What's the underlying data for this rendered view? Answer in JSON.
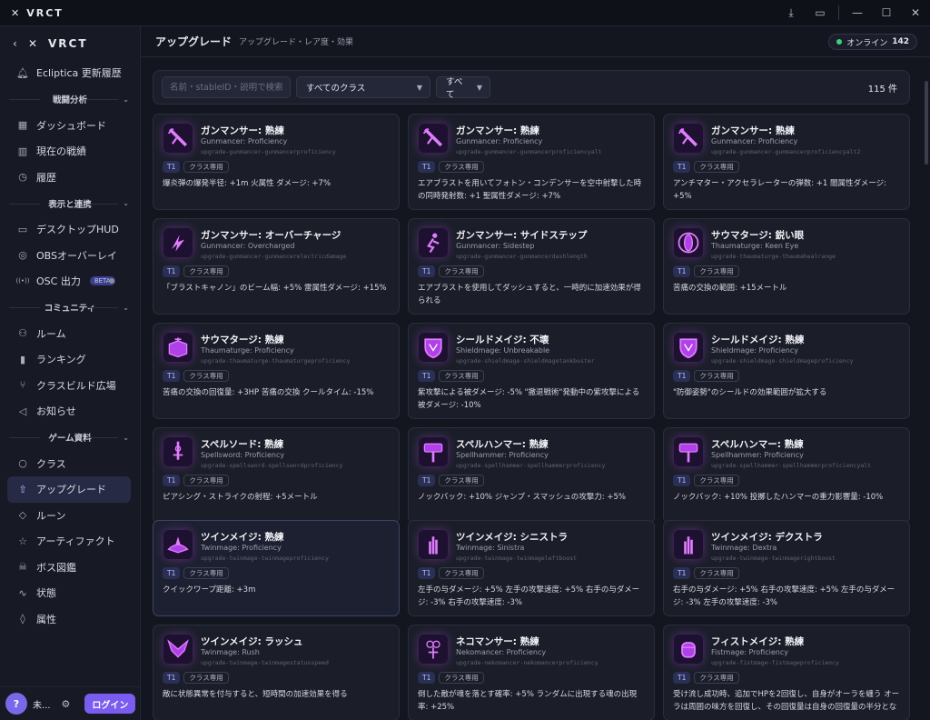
{
  "app": {
    "title": "VRCT"
  },
  "window": {
    "controls": [
      "download",
      "chat",
      "minimize",
      "maximize",
      "close"
    ]
  },
  "sidebar": {
    "brand": "VRCT",
    "top_item": {
      "label": "Ecliptica 更新履歴",
      "icon": "bell-icon"
    },
    "sections": [
      {
        "title": "戦闘分析",
        "items": [
          {
            "label": "ダッシュボード",
            "icon": "dashboard-icon"
          },
          {
            "label": "現在の戦績",
            "icon": "bars-icon"
          },
          {
            "label": "履歴",
            "icon": "clock-icon"
          }
        ]
      },
      {
        "title": "表示と連携",
        "items": [
          {
            "label": "デスクトップHUD",
            "icon": "monitor-icon"
          },
          {
            "label": "OBSオーバーレイ",
            "icon": "target-icon"
          },
          {
            "label": "OSC 出力",
            "icon": "signal-icon",
            "badge": "BETA"
          }
        ]
      },
      {
        "title": "コミュニティ",
        "items": [
          {
            "label": "ルーム",
            "icon": "users-icon"
          },
          {
            "label": "ランキング",
            "icon": "chart-icon"
          },
          {
            "label": "クラスビルド広場",
            "icon": "branch-icon"
          },
          {
            "label": "お知らせ",
            "icon": "speaker-icon"
          }
        ]
      },
      {
        "title": "ゲーム資料",
        "items": [
          {
            "label": "クラス",
            "icon": "circle-icon"
          },
          {
            "label": "アップグレード",
            "icon": "arrow-up-icon",
            "active": true
          },
          {
            "label": "ルーン",
            "icon": "diamond-icon"
          },
          {
            "label": "アーティファクト",
            "icon": "star-icon"
          },
          {
            "label": "ボス図鑑",
            "icon": "skull-icon"
          },
          {
            "label": "状態",
            "icon": "pulse-icon"
          },
          {
            "label": "属性",
            "icon": "drop-icon"
          }
        ]
      }
    ],
    "footer": {
      "avatar": "?",
      "user": "未...",
      "login": "ログイン"
    }
  },
  "header": {
    "title": "アップグレード",
    "subtitle": "アップグレード・レア度・効果",
    "online_label": "オンライン",
    "online_count": "142"
  },
  "filters": {
    "search_placeholder": "名前・stableID・説明で検索",
    "class_select": "すべてのクラス",
    "type_select": "すべて",
    "count": "115 件"
  },
  "colors": {
    "accent": "#7b5cf0",
    "tier_badge": "#2a2f55",
    "online": "#3ed17a",
    "icon_glow": "#d070ff"
  },
  "cards": [
    {
      "name": "ガンマンサー: 熟練",
      "en": "Gunmancer: Proficiency",
      "id": "upgrade-gunmancer-gunmancerproficiency",
      "tier": "T1",
      "cls": "クラス専用",
      "desc": "爆炎弾の爆発半径: +1m 火属性 ダメージ: +7%",
      "icon": "gun-icon"
    },
    {
      "name": "ガンマンサー: 熟練",
      "en": "Gunmancer: Proficiency",
      "id": "upgrade-gunmancer-gunmancerproficiencyalt",
      "tier": "T1",
      "cls": "クラス専用",
      "desc": "エアブラストを用いてフォトン・コンデンサーを空中射撃した時の同時発射数: +1 聖属性ダメージ: +7%",
      "icon": "gun-icon"
    },
    {
      "name": "ガンマンサー: 熟練",
      "en": "Gunmancer: Proficiency",
      "id": "upgrade-gunmancer-gunmancerproficiencyalt2",
      "tier": "T1",
      "cls": "クラス専用",
      "desc": "アンチマター・アクセラレーターの弾数: +1 闇属性ダメージ: +5%",
      "icon": "gun-icon"
    },
    {
      "name": "ガンマンサー: オーバーチャージ",
      "en": "Gunmancer: Overcharged",
      "id": "upgrade-gunmancer-gunmancerelectricdamage",
      "tier": "T1",
      "cls": "クラス専用",
      "desc": "「ブラストキャノン」のビーム幅: +5% 雷属性ダメージ: +15%",
      "icon": "bolt-icon"
    },
    {
      "name": "ガンマンサー: サイドステップ",
      "en": "Gunmancer: Sidestep",
      "id": "upgrade-gunmancer-gunmancerdashlength",
      "tier": "T1",
      "cls": "クラス専用",
      "desc": "エアブラストを使用してダッシュすると、一時的に加速効果が得られる",
      "icon": "dash-icon"
    },
    {
      "name": "サウマタージ: 鋭い眼",
      "en": "Thaumaturge: Keen Eye",
      "id": "upgrade-thaumaturge-thaumahealrange",
      "tier": "T1",
      "cls": "クラス専用",
      "desc": "苦痛の交換の範囲: +15メートル",
      "icon": "eye-icon"
    },
    {
      "name": "サウマタージ: 熟練",
      "en": "Thaumaturge: Proficiency",
      "id": "upgrade-thaumaturge-thaumaturgeproficiency",
      "tier": "T1",
      "cls": "クラス専用",
      "desc": "苦痛の交換の回復量: +3HP 苦痛の交換 クールタイム: -15%",
      "icon": "book-icon"
    },
    {
      "name": "シールドメイジ: 不壊",
      "en": "Shieldmage: Unbreakable",
      "id": "upgrade-shieldmage-shieldmagetankbuster",
      "tier": "T1",
      "cls": "クラス専用",
      "desc": "紫攻撃による被ダメージ: -5% \"撤退戦術\"発動中の紫攻撃による被ダメージ: -10%",
      "icon": "shield-icon"
    },
    {
      "name": "シールドメイジ: 熟練",
      "en": "Shieldmage: Proficiency",
      "id": "upgrade-shieldmage-shieldmageproficiency",
      "tier": "T1",
      "cls": "クラス専用",
      "desc": "\"防御姿勢\"のシールドの効果範囲が拡大する",
      "icon": "shield-icon"
    },
    {
      "name": "スペルソード: 熟練",
      "en": "Spellsword: Proficiency",
      "id": "upgrade-spellsword-spellswordproficiency",
      "tier": "T1",
      "cls": "クラス専用",
      "desc": "ピアシング・ストライクの射程: +5メートル",
      "icon": "sword-icon"
    },
    {
      "name": "スペルハンマー: 熟練",
      "en": "Spellhammer: Proficiency",
      "id": "upgrade-spellhammer-spellhammerproficiency",
      "tier": "T1",
      "cls": "クラス専用",
      "desc": "ノックバック: +10% ジャンプ・スマッシュの攻撃力: +5%",
      "icon": "hammer-icon"
    },
    {
      "name": "スペルハンマー: 熟練",
      "en": "Spellhammer: Proficiency",
      "id": "upgrade-spellhammer-spellhammerproficiencyalt",
      "tier": "T1",
      "cls": "クラス専用",
      "desc": "ノックバック: +10% 投擲したハンマーの重力影響量: -10%",
      "icon": "hammer-icon"
    },
    {
      "name": "ツインメイジ: 熟練",
      "en": "Twinmage: Proficiency",
      "id": "upgrade-twinmage-twinmageproficiency",
      "tier": "T1",
      "cls": "クラス専用",
      "desc": "クイックワープ距離: +3m",
      "icon": "hands-icon",
      "highlight": true
    },
    {
      "name": "ツインメイジ: シニストラ",
      "en": "Twinmage: Sinistra",
      "id": "upgrade-twinmage-twinmageleftboost",
      "tier": "T1",
      "cls": "クラス専用",
      "desc": "左手の与ダメージ: +5% 左手の攻撃速度: +5% 右手の与ダメージ: -3% 右手の攻撃速度: -3%",
      "icon": "hand-icon"
    },
    {
      "name": "ツインメイジ: デクストラ",
      "en": "Twinmage: Dextra",
      "id": "upgrade-twinmage-twinmagerightboost",
      "tier": "T1",
      "cls": "クラス専用",
      "desc": "右手の与ダメージ: +5% 右手の攻撃速度: +5% 左手の与ダメージ: -3% 左手の攻撃速度: -3%",
      "icon": "hand-icon"
    },
    {
      "name": "ツインメイジ: ラッシュ",
      "en": "Twinmage: Rush",
      "id": "upgrade-twinmage-twinmagestatusspeed",
      "tier": "T1",
      "cls": "クラス専用",
      "desc": "敵に状態異常を付与すると、短時間の加速効果を得る",
      "icon": "wings-icon"
    },
    {
      "name": "ネコマンサー: 熟練",
      "en": "Nekomancer: Proficiency",
      "id": "upgrade-nekomancer-nekomancerproficiency",
      "tier": "T1",
      "cls": "クラス専用",
      "desc": "倒した敵が魂を落とす確率: +5% ランダムに出現する魂の出現率: +25%",
      "icon": "cat-icon"
    },
    {
      "name": "フィストメイジ: 熟練",
      "en": "Fistmage: Proficiency",
      "id": "upgrade-fistmage-fistmageproficiency",
      "tier": "T1",
      "cls": "クラス専用",
      "desc": "受け流し成功時、追加でHPを2回復し、自身がオーラを纏う オーラは周囲の味方を回復し、その回復量は自身の回復量の半分となる",
      "icon": "fist-icon"
    }
  ]
}
